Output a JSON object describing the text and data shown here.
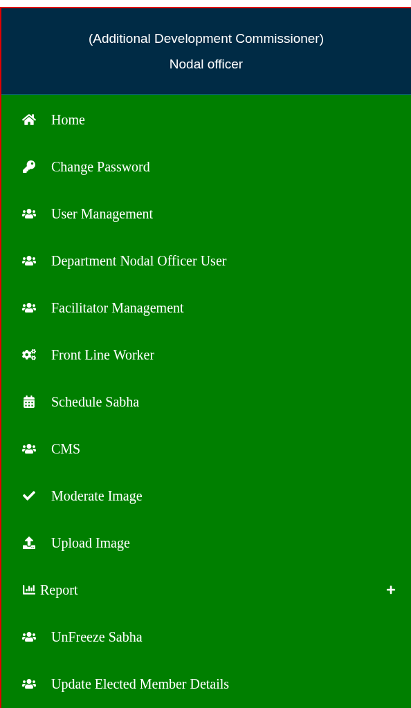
{
  "header": {
    "lines": [
      "(Additional Development Commissioner)",
      "Nodal officer"
    ]
  },
  "menu": [
    {
      "kind": "home",
      "label": "Home"
    },
    {
      "kind": "key",
      "label": "Change Password"
    },
    {
      "kind": "users",
      "label": "User Management"
    },
    {
      "kind": "users",
      "label": "Department Nodal Officer User"
    },
    {
      "kind": "users",
      "label": "Facilitator Management"
    },
    {
      "kind": "cogs",
      "label": "Front Line Worker"
    },
    {
      "kind": "calendar",
      "label": "Schedule Sabha"
    },
    {
      "kind": "users",
      "label": "CMS"
    },
    {
      "kind": "check",
      "label": "Moderate Image"
    },
    {
      "kind": "upload",
      "label": "Upload Image"
    },
    {
      "kind": "chart",
      "label": "Report",
      "expanded": false
    },
    {
      "kind": "users",
      "label": "UnFreeze Sabha"
    },
    {
      "kind": "users",
      "label": "Update Elected Member Details"
    }
  ]
}
